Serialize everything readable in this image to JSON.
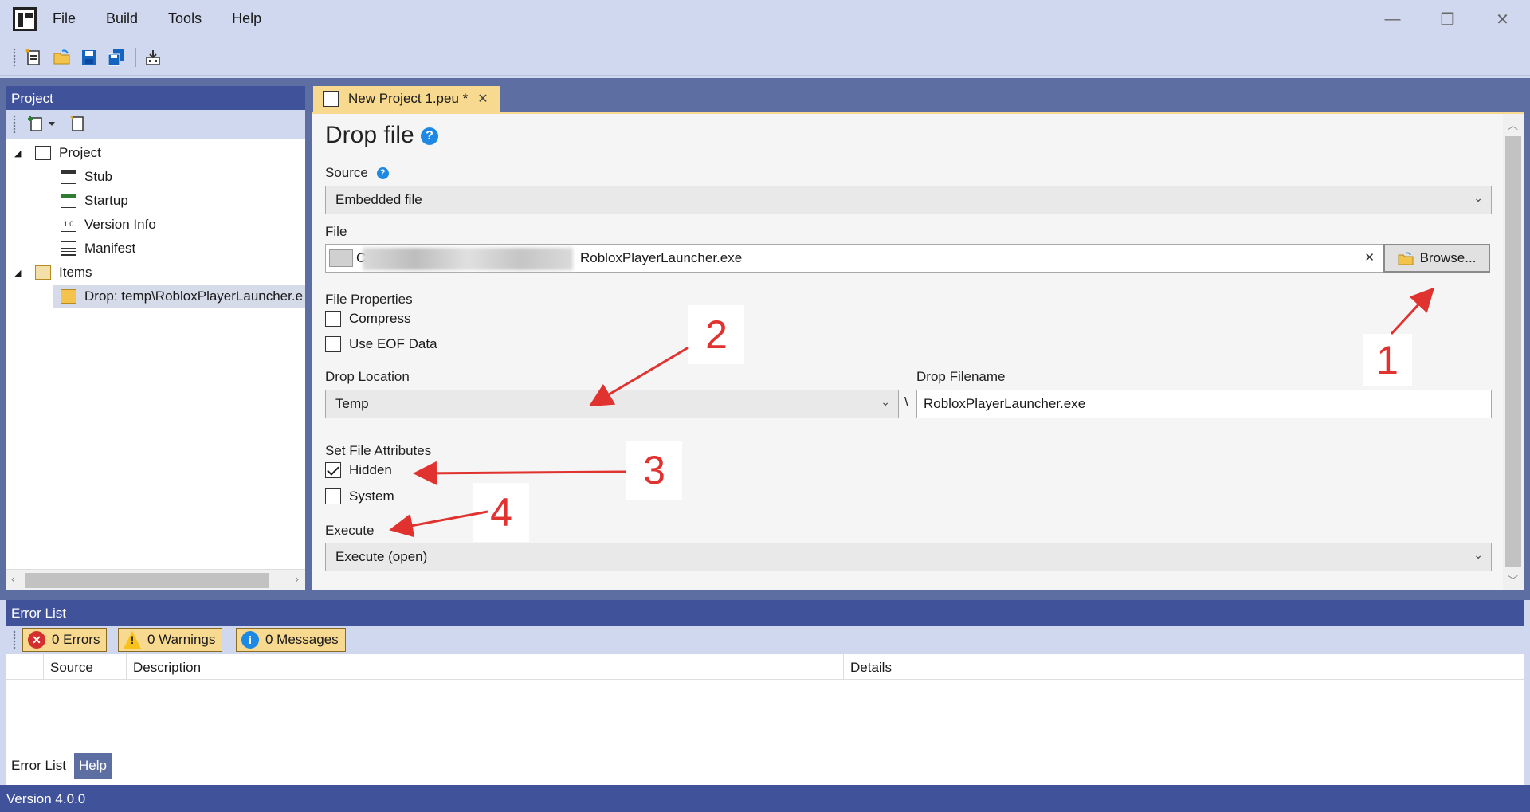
{
  "menu": {
    "items": [
      "File",
      "Build",
      "Tools",
      "Help"
    ]
  },
  "window_controls": {
    "minimize": "—",
    "restore": "❐",
    "close": "✕"
  },
  "project_panel": {
    "title": "Project",
    "tree": [
      {
        "label": "Project",
        "icon": "project-icon",
        "level": 0,
        "expanded": true
      },
      {
        "label": "Stub",
        "icon": "window-icon",
        "level": 1
      },
      {
        "label": "Startup",
        "icon": "startup-icon",
        "level": 1
      },
      {
        "label": "Version Info",
        "icon": "version-info-icon",
        "level": 1
      },
      {
        "label": "Manifest",
        "icon": "manifest-icon",
        "level": 1
      },
      {
        "label": "Items",
        "icon": "folder-icon",
        "level": 0,
        "expanded": true
      },
      {
        "label": "Drop: temp\\RobloxPlayerLauncher.e",
        "icon": "drop-file-icon",
        "level": 1,
        "selected": true
      }
    ]
  },
  "document_tab": {
    "label": "New Project 1.peu *",
    "close": "✕"
  },
  "form": {
    "heading": "Drop file",
    "help": "?",
    "source_label": "Source",
    "source_value": "Embedded file",
    "file_label": "File",
    "file_value_start": "C",
    "file_value_end": "RobloxPlayerLauncher.exe",
    "file_clear": "✕",
    "browse_label": "Browse...",
    "file_properties_label": "File Properties",
    "compress_label": "Compress",
    "compress_checked": false,
    "use_eof_label": "Use EOF Data",
    "use_eof_checked": false,
    "drop_location_label": "Drop Location",
    "drop_location_value": "Temp",
    "path_separator": "\\",
    "drop_filename_label": "Drop Filename",
    "drop_filename_value": "RobloxPlayerLauncher.exe",
    "attributes_label": "Set File Attributes",
    "hidden_label": "Hidden",
    "hidden_checked": true,
    "system_label": "System",
    "system_checked": false,
    "execute_label": "Execute",
    "execute_value": "Execute (open)"
  },
  "annotations": {
    "one": "1",
    "two": "2",
    "three": "3",
    "four": "4",
    "color": "#e0322f"
  },
  "error_list": {
    "title": "Error List",
    "errors_label": "0 Errors",
    "warnings_label": "0 Warnings",
    "messages_label": "0 Messages",
    "columns": [
      "Source",
      "Description",
      "Details"
    ]
  },
  "bottom_tabs": {
    "error_list": "Error List",
    "help": "Help"
  },
  "status": {
    "version": "Version 4.0.0"
  },
  "colors": {
    "panel_header": "#40539a",
    "chrome": "#cfd8ee",
    "active_tab": "#f7d98f",
    "workspace": "#5d6ea2"
  }
}
